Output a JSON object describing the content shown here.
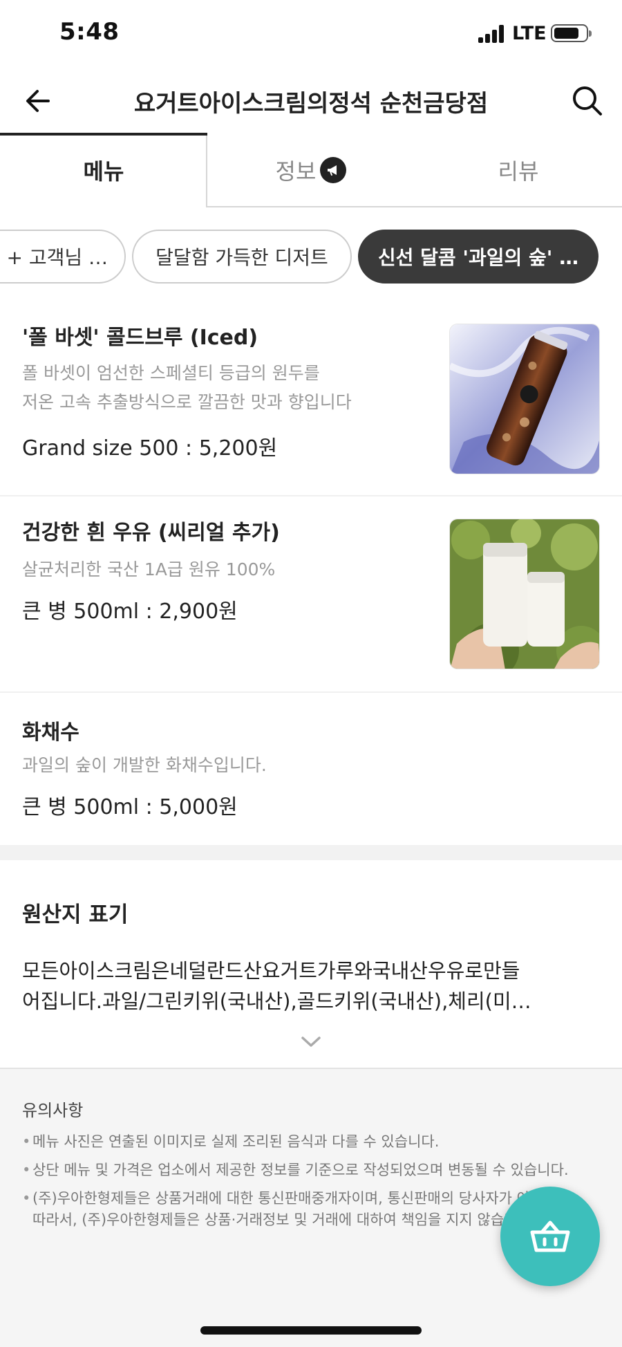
{
  "status_bar": {
    "time": "5:48",
    "network": "LTE"
  },
  "header": {
    "title": "요거트아이스크림의정석 순천금당점",
    "back_icon": "arrow-left-icon",
    "search_icon": "search-icon"
  },
  "tabs": [
    {
      "label": "메뉴",
      "active": true
    },
    {
      "label": "정보",
      "active": false,
      "badge_icon": "megaphone-icon"
    },
    {
      "label": "리뷰",
      "active": false
    }
  ],
  "categories": [
    {
      "label": "+ 고객님 …",
      "active": false
    },
    {
      "label": "달달함 가득한 디저트",
      "active": false
    },
    {
      "label": "신선 달콤 '과일의 숲' …",
      "active": true
    }
  ],
  "menu_items": [
    {
      "name": "'폴 바셋' 콜드브루 (Iced)",
      "description": [
        "폴 바셋이 엄선한 스페셜티 등급의 원두를",
        "저온 고속 추출방식으로 깔끔한 맛과 향입니다"
      ],
      "price": "Grand size 500 : 5,200원",
      "image": "coldbrew-bottle-photo"
    },
    {
      "name": "건강한 흰 우유 (씨리얼 추가)",
      "description": [
        "살균처리한 국산 1A급 원유 100%"
      ],
      "price": "큰 병 500ml : 2,900원",
      "image": "milk-bottles-photo"
    },
    {
      "name": "화채수",
      "description": [
        "과일의 숲이 개발한 화채수입니다."
      ],
      "price": "큰 병 500ml : 5,000원"
    }
  ],
  "origin": {
    "title": "원산지 표기",
    "lines": [
      "모든아이스크림은네덜란드산요거트가루와국내산우유로만들",
      "어집니다.과일/그린키위(국내산),골드키위(국내산),체리(미…"
    ],
    "expand_icon": "chevron-down-icon"
  },
  "notice": {
    "title": "유의사항",
    "items": [
      [
        "메뉴 사진은 연출된 이미지로 실제 조리된 음식과 다를 수 있습니다."
      ],
      [
        "상단 메뉴 및 가격은 업소에서 제공한 정보를 기준으로 작성되었으며 변동될 수 있습니다."
      ],
      [
        "(주)우아한형제들은 상품거래에 대한 통신판매중개자이며, 통신판매의 당사자가 아닙니다.",
        "따라서, (주)우아한형제들은 상품·거래정보 및 거래에 대하여 책임을 지지 않습니다."
      ]
    ]
  },
  "cart": {
    "icon": "basket-icon"
  },
  "colors": {
    "accent": "#3dbfbb",
    "active_chip": "#3a3a3a",
    "muted_text": "#999999"
  }
}
